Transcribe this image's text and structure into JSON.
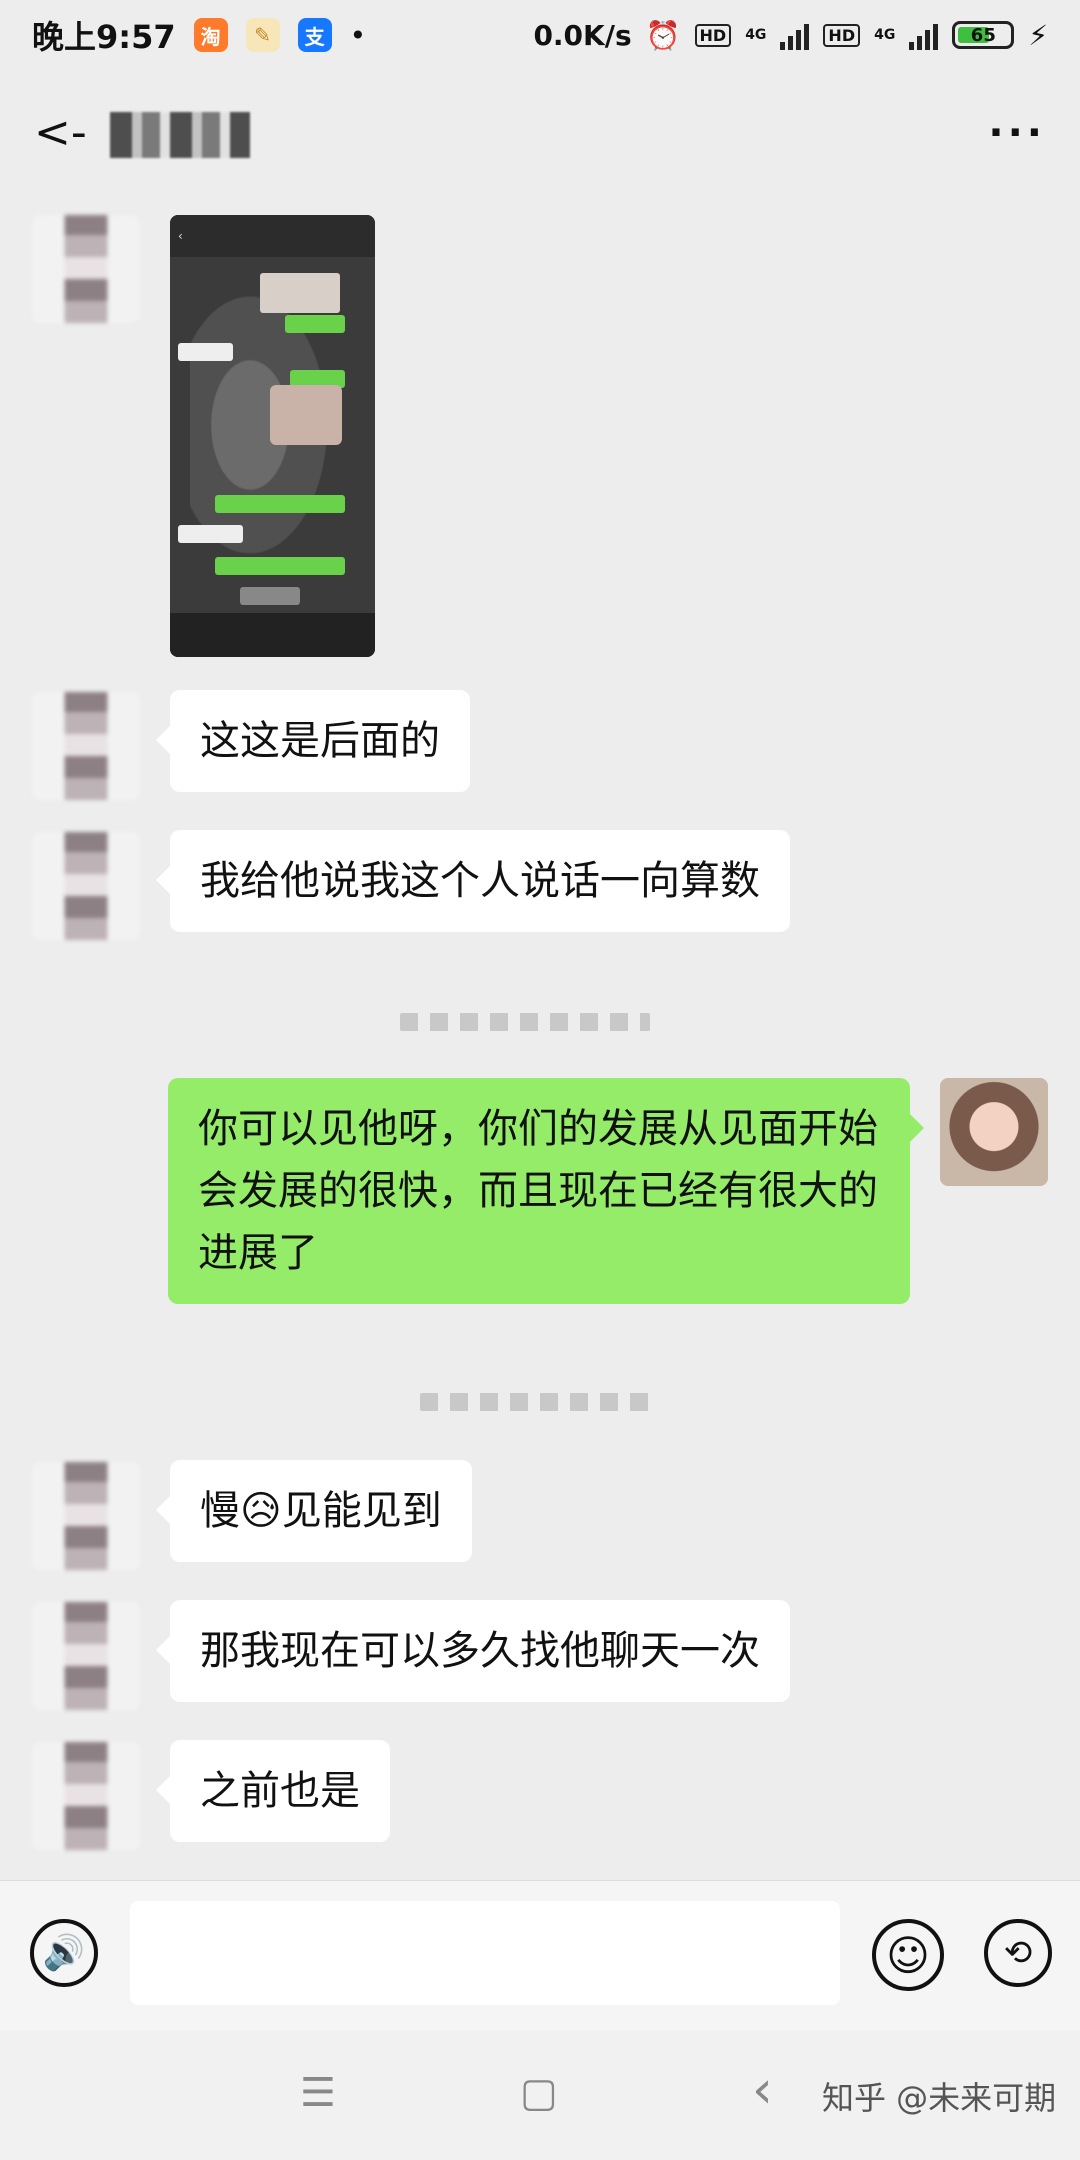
{
  "status_bar": {
    "time": "晚上9:57",
    "net_speed": "0.0K/s",
    "battery": "65",
    "hd1": "HD",
    "hd2": "HD",
    "net1": "4G",
    "net2": "4G",
    "icons": [
      "taobao-icon",
      "notes-icon",
      "alipay-icon",
      "alarm-icon",
      "signal-icon",
      "battery-icon",
      "charging-icon"
    ]
  },
  "header": {
    "back_icon": "back-arrow-icon",
    "title": "",
    "more_icon": "more-icon"
  },
  "messages": [
    {
      "side": "left",
      "type": "image"
    },
    {
      "side": "left",
      "type": "text",
      "text": "这这是后面的"
    },
    {
      "side": "left",
      "type": "text",
      "text": "我给他说我这个人说话一向算数"
    },
    {
      "side": "right",
      "type": "text",
      "text": "你可以见他呀，你们的发展从见面开始会发展的很快，而且现在已经有很大的进展了"
    },
    {
      "side": "left",
      "type": "text",
      "text_before": "慢",
      "emoji": "😥",
      "text_after": "见能见到"
    },
    {
      "side": "left",
      "type": "text",
      "text": "那我现在可以多久找他聊天一次"
    },
    {
      "side": "left",
      "type": "text",
      "text": "之前也是"
    }
  ],
  "input_bar": {
    "voice_icon": "voice-icon",
    "voice_glyph": "🔊",
    "emoji_icon": "emoji-icon",
    "emoji_glyph": "☺",
    "more_icon": "history-icon",
    "more_glyph": "⟲"
  },
  "nav_bar": {
    "menu_glyph": "☰",
    "home_glyph": "▢",
    "back_glyph": "‹"
  },
  "watermark": "知乎 @未来可期",
  "colors": {
    "green_bubble": "#95ec69",
    "background": "#ededed"
  }
}
